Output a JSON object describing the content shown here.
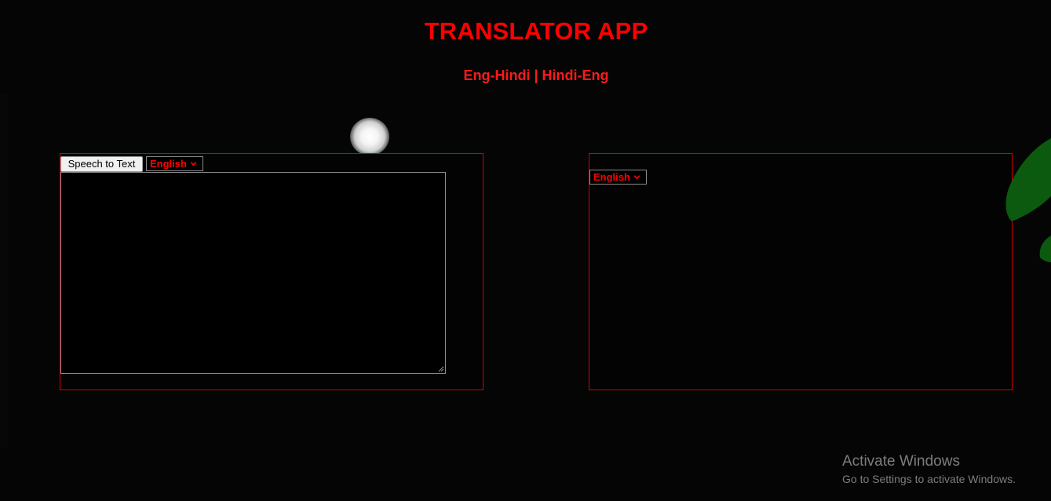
{
  "header": {
    "title": "TRANSLATOR APP",
    "subtitle": "Eng-Hindi | Hindi-Eng"
  },
  "source_panel": {
    "speech_button_label": "Speech to Text",
    "language_selected": "English",
    "text_value": ""
  },
  "target_panel": {
    "language_selected": "English"
  },
  "watermark": {
    "title": "Activate Windows",
    "subtitle": "Go to Settings to activate Windows."
  },
  "colors": {
    "background": "#050505",
    "accent": "#ff0000",
    "panel_border": "#d40000",
    "watermark_text": "#7d7d7d"
  },
  "icons": [
    "chevron-down-icon",
    "resize-grip-icon",
    "leaf-decoration"
  ]
}
